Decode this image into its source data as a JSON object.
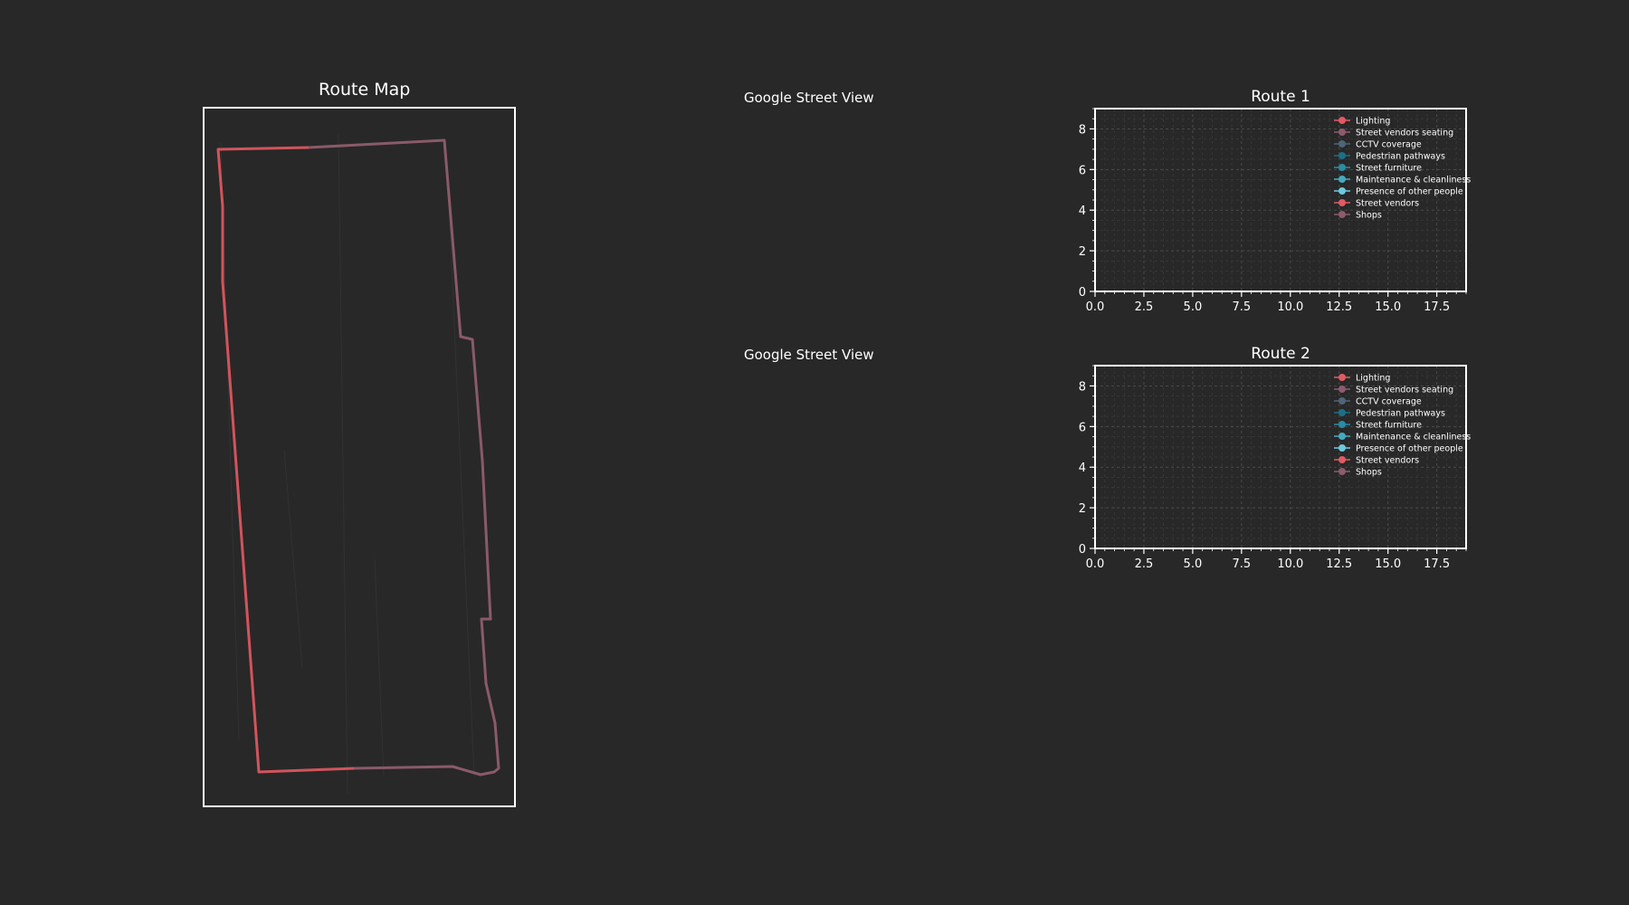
{
  "background_color": "#282828",
  "route_map": {
    "title": "Route Map",
    "frame_color": "#ffffff",
    "route_colors": [
      "#d2545c",
      "#8a5a68"
    ]
  },
  "street_view": {
    "label_1": "Google Street View",
    "label_2": "Google Street View"
  },
  "chart_data": [
    {
      "type": "line",
      "title": "Route 1",
      "xlabel": "",
      "ylabel": "",
      "xlim": [
        0,
        19
      ],
      "ylim": [
        0,
        9
      ],
      "xticks": [
        "0.0",
        "2.5",
        "5.0",
        "7.5",
        "10.0",
        "12.5",
        "15.0",
        "17.5"
      ],
      "yticks": [
        "0",
        "2",
        "4",
        "6",
        "8"
      ],
      "grid": true,
      "legend_position": "top-right",
      "series": [
        {
          "name": "Lighting",
          "color": "#e05a64",
          "x": [],
          "y": []
        },
        {
          "name": "Street vendors seating",
          "color": "#8d5a6e",
          "x": [],
          "y": []
        },
        {
          "name": "CCTV coverage",
          "color": "#506478",
          "x": [],
          "y": []
        },
        {
          "name": "Pedestrian pathways",
          "color": "#1e6e87",
          "x": [],
          "y": []
        },
        {
          "name": "Street furniture",
          "color": "#2a8ca5",
          "x": [],
          "y": []
        },
        {
          "name": "Maintenance & cleanliness",
          "color": "#46aabe",
          "x": [],
          "y": []
        },
        {
          "name": "Presence of other people",
          "color": "#6ec8dc",
          "x": [],
          "y": []
        },
        {
          "name": "Street vendors",
          "color": "#e05a64",
          "x": [],
          "y": []
        },
        {
          "name": "Shops",
          "color": "#8d5a6e",
          "x": [],
          "y": []
        }
      ]
    },
    {
      "type": "line",
      "title": "Route 2",
      "xlabel": "",
      "ylabel": "",
      "xlim": [
        0,
        19
      ],
      "ylim": [
        0,
        9
      ],
      "xticks": [
        "0.0",
        "2.5",
        "5.0",
        "7.5",
        "10.0",
        "12.5",
        "15.0",
        "17.5"
      ],
      "yticks": [
        "0",
        "2",
        "4",
        "6",
        "8"
      ],
      "grid": true,
      "legend_position": "top-right",
      "series": [
        {
          "name": "Lighting",
          "color": "#e05a64",
          "x": [],
          "y": []
        },
        {
          "name": "Street vendors seating",
          "color": "#8d5a6e",
          "x": [],
          "y": []
        },
        {
          "name": "CCTV coverage",
          "color": "#506478",
          "x": [],
          "y": []
        },
        {
          "name": "Pedestrian pathways",
          "color": "#1e6e87",
          "x": [],
          "y": []
        },
        {
          "name": "Street furniture",
          "color": "#2a8ca5",
          "x": [],
          "y": []
        },
        {
          "name": "Maintenance & cleanliness",
          "color": "#46aabe",
          "x": [],
          "y": []
        },
        {
          "name": "Presence of other people",
          "color": "#6ec8dc",
          "x": [],
          "y": []
        },
        {
          "name": "Street vendors",
          "color": "#e05a64",
          "x": [],
          "y": []
        },
        {
          "name": "Shops",
          "color": "#8d5a6e",
          "x": [],
          "y": []
        }
      ]
    }
  ]
}
